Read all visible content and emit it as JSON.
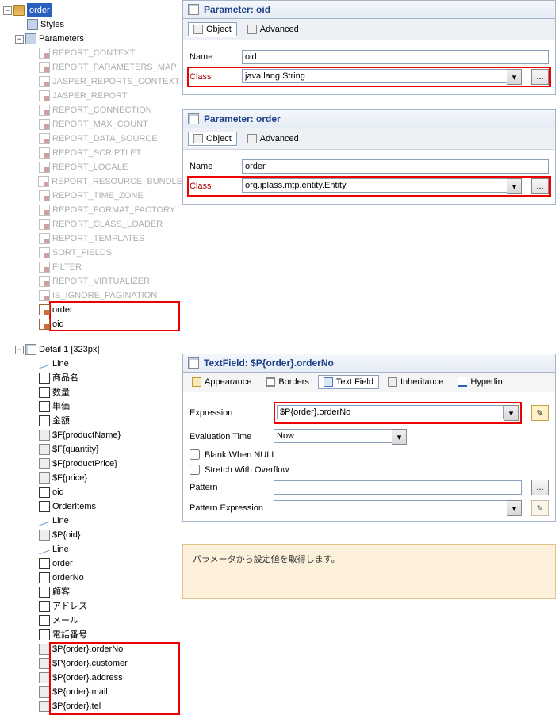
{
  "tree": {
    "root": "order",
    "styles": "Styles",
    "parameters_label": "Parameters",
    "params_ghost": [
      "REPORT_CONTEXT",
      "REPORT_PARAMETERS_MAP",
      "JASPER_REPORTS_CONTEXT",
      "JASPER_REPORT",
      "REPORT_CONNECTION",
      "REPORT_MAX_COUNT",
      "REPORT_DATA_SOURCE",
      "REPORT_SCRIPTLET",
      "REPORT_LOCALE",
      "REPORT_RESOURCE_BUNDLE",
      "REPORT_TIME_ZONE",
      "REPORT_FORMAT_FACTORY",
      "REPORT_CLASS_LOADER",
      "REPORT_TEMPLATES",
      "SORT_FIELDS",
      "FILTER",
      "REPORT_VIRTUALIZER",
      "IS_IGNORE_PAGINATION"
    ],
    "params_user": [
      "order",
      "oid"
    ],
    "detail_label": "Detail 1 [323px]",
    "detail_items": [
      {
        "t": "line",
        "l": "Line"
      },
      {
        "t": "label",
        "l": "商品名"
      },
      {
        "t": "label",
        "l": "数量"
      },
      {
        "t": "label",
        "l": "単価"
      },
      {
        "t": "label",
        "l": "金額"
      },
      {
        "t": "tf",
        "l": "$F{productName}"
      },
      {
        "t": "tf",
        "l": "$F{quantity}"
      },
      {
        "t": "tf",
        "l": "$F{productPrice}"
      },
      {
        "t": "tf",
        "l": "$F{price}"
      },
      {
        "t": "label",
        "l": "oid"
      },
      {
        "t": "label",
        "l": "OrderItems"
      },
      {
        "t": "line",
        "l": "Line"
      },
      {
        "t": "tf",
        "l": "$P{oid}"
      },
      {
        "t": "line",
        "l": "Line"
      },
      {
        "t": "label",
        "l": "order"
      },
      {
        "t": "label",
        "l": "orderNo"
      },
      {
        "t": "label",
        "l": "顧客"
      },
      {
        "t": "label",
        "l": "アドレス"
      },
      {
        "t": "label",
        "l": "メール"
      },
      {
        "t": "label",
        "l": "電話番号"
      },
      {
        "t": "tf",
        "l": "$P{order}.orderNo"
      },
      {
        "t": "tf",
        "l": "$P{order}.customer"
      },
      {
        "t": "tf",
        "l": "$P{order}.address"
      },
      {
        "t": "tf",
        "l": "$P{order}.mail"
      },
      {
        "t": "tf",
        "l": "$P{order}.tel"
      }
    ]
  },
  "panel_oid": {
    "title": "Parameter: oid",
    "tab_object": "Object",
    "tab_advanced": "Advanced",
    "name_label": "Name",
    "name_value": "oid",
    "class_label": "Class",
    "class_value": "java.lang.String",
    "dots": "..."
  },
  "panel_order": {
    "title": "Parameter: order",
    "tab_object": "Object",
    "tab_advanced": "Advanced",
    "name_label": "Name",
    "name_value": "order",
    "class_label": "Class",
    "class_value": "org.iplass.mtp.entity.Entity",
    "dots": "..."
  },
  "panel_tf": {
    "title": "TextField: $P{order}.orderNo",
    "tabs": {
      "appearance": "Appearance",
      "borders": "Borders",
      "textfield": "Text Field",
      "inheritance": "Inheritance",
      "hyperlink": "Hyperlin"
    },
    "expression_label": "Expression",
    "expression_value": "$P{order}.orderNo",
    "eval_label": "Evaluation Time",
    "eval_value": "Now",
    "blank_label": "Blank When NULL",
    "stretch_label": "Stretch With Overflow",
    "pattern_label": "Pattern",
    "pattern_value": "",
    "pattern_expr_label": "Pattern Expression",
    "pattern_expr_value": "",
    "dots": "..."
  },
  "callout_text": "パラメータから設定値を取得します。",
  "toggle_minus": "−",
  "toggle_plus": "+",
  "caret_down": "▾"
}
